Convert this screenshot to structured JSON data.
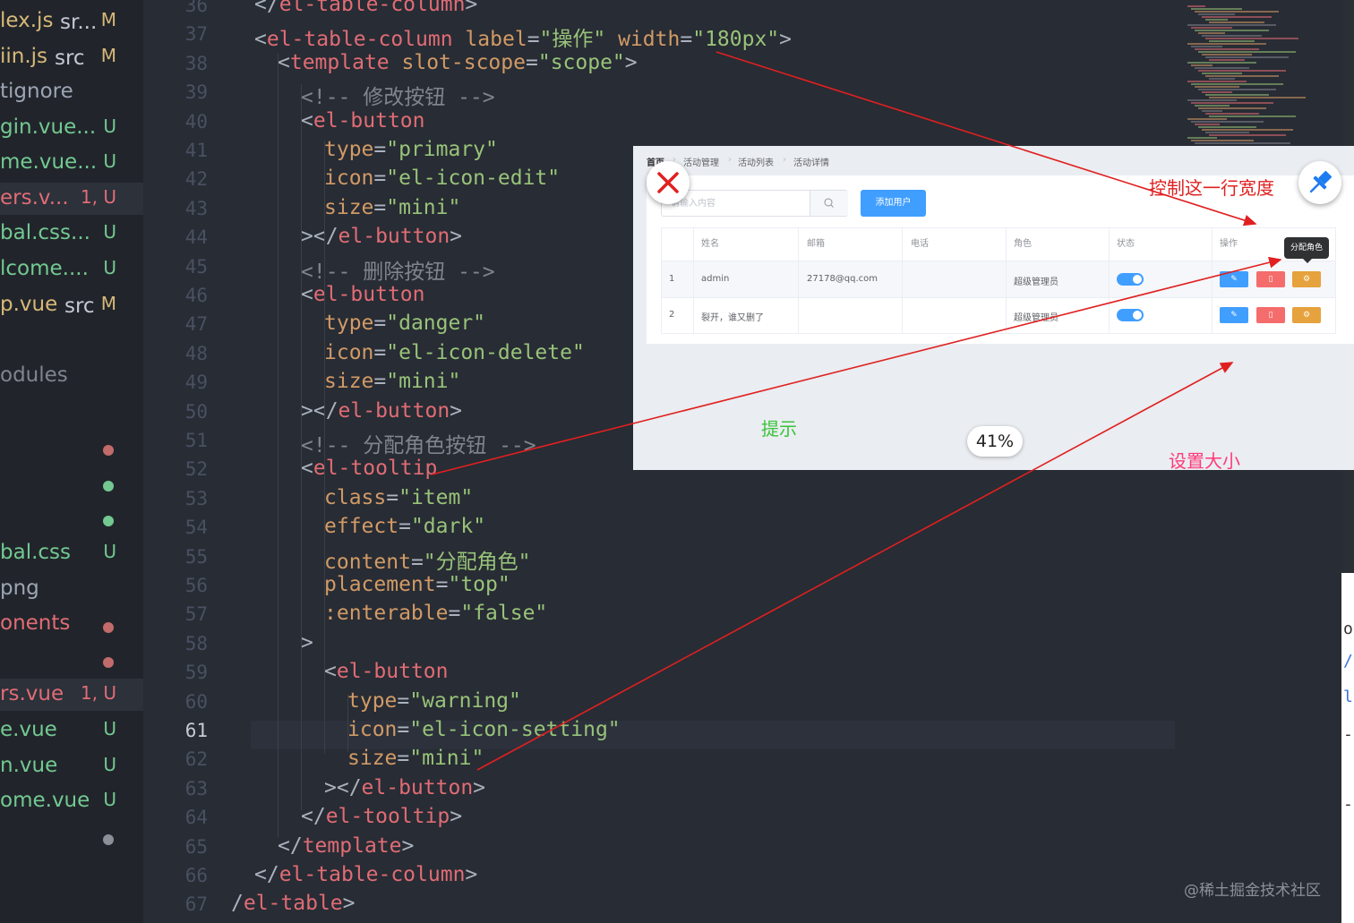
{
  "sidebar": {
    "files": [
      {
        "name": "lex.js",
        "sub": "sr...",
        "badge": "M",
        "color": "#d7b978",
        "badge_color": "#d7b978"
      },
      {
        "name": "iin.js",
        "sub": "src",
        "badge": "M",
        "color": "#d7b978",
        "badge_color": "#d7b978"
      },
      {
        "name": "tignore",
        "sub": "",
        "badge": "",
        "color": "#9da5b4",
        "badge_color": ""
      },
      {
        "name": "gin.vue...",
        "sub": "",
        "badge": "U",
        "color": "#73c991",
        "badge_color": "#73c991"
      },
      {
        "name": "me.vue...",
        "sub": "",
        "badge": "U",
        "color": "#73c991",
        "badge_color": "#73c991"
      },
      {
        "name": "ers.v...",
        "sub": "",
        "badge": "1, U",
        "color": "#e06c75",
        "badge_color": "#e06c75"
      },
      {
        "name": "bal.css...",
        "sub": "",
        "badge": "U",
        "color": "#73c991",
        "badge_color": "#73c991"
      },
      {
        "name": "lcome....",
        "sub": "",
        "badge": "U",
        "color": "#73c991",
        "badge_color": "#73c991"
      },
      {
        "name": "p.vue",
        "sub": "src",
        "badge": "M",
        "color": "#d7b978",
        "badge_color": "#d7b978"
      },
      {
        "name": "odules",
        "sub": "",
        "badge": "",
        "color": "#7f848e",
        "badge_color": ""
      },
      {
        "name": "bal.css",
        "sub": "",
        "badge": "U",
        "color": "#73c991",
        "badge_color": "#73c991"
      },
      {
        "name": "png",
        "sub": "",
        "badge": "",
        "color": "#9da5b4",
        "badge_color": ""
      },
      {
        "name": "onents",
        "sub": "",
        "badge": "",
        "color": "#e06c75",
        "badge_color": ""
      },
      {
        "name": "rs.vue",
        "sub": "",
        "badge": "1, U",
        "color": "#e06c75",
        "badge_color": "#e06c75"
      },
      {
        "name": "e.vue",
        "sub": "",
        "badge": "U",
        "color": "#73c991",
        "badge_color": "#73c991"
      },
      {
        "name": "n.vue",
        "sub": "",
        "badge": "U",
        "color": "#73c991",
        "badge_color": "#73c991"
      },
      {
        "name": "ome.vue",
        "sub": "",
        "badge": "U",
        "color": "#73c991",
        "badge_color": "#73c991"
      }
    ],
    "dot_colors": [
      "#c26b6b",
      "#73c991",
      "#73c991",
      "#c26b6b",
      "#c26b6b",
      "#8a8f98"
    ]
  },
  "editor": {
    "current_line": 61,
    "lines": [
      {
        "n": 36,
        "indent": 0,
        "parts": [
          [
            "pun",
            "</"
          ],
          [
            "tag",
            "el-table-column"
          ],
          [
            "pun",
            ">"
          ]
        ]
      },
      {
        "n": 37,
        "indent": 0,
        "parts": [
          [
            "pun",
            "<"
          ],
          [
            "tag",
            "el-table-column"
          ],
          [
            "pun",
            " "
          ],
          [
            "attr",
            "label"
          ],
          [
            "pun",
            "="
          ],
          [
            "str",
            "\"操作\""
          ],
          [
            "pun",
            " "
          ],
          [
            "attr",
            "width"
          ],
          [
            "pun",
            "="
          ],
          [
            "str",
            "\"180px\""
          ],
          [
            "pun",
            ">"
          ]
        ]
      },
      {
        "n": 38,
        "indent": 1,
        "parts": [
          [
            "pun",
            "<"
          ],
          [
            "tag",
            "template"
          ],
          [
            "pun",
            " "
          ],
          [
            "attr",
            "slot-scope"
          ],
          [
            "pun",
            "="
          ],
          [
            "str",
            "\"scope\""
          ],
          [
            "pun",
            ">"
          ]
        ]
      },
      {
        "n": 39,
        "indent": 2,
        "parts": [
          [
            "cmt",
            "<!-- 修改按钮 -->"
          ]
        ]
      },
      {
        "n": 40,
        "indent": 2,
        "parts": [
          [
            "pun",
            "<"
          ],
          [
            "tag",
            "el-button"
          ]
        ]
      },
      {
        "n": 41,
        "indent": 3,
        "parts": [
          [
            "attr",
            "type"
          ],
          [
            "pun",
            "="
          ],
          [
            "str",
            "\"primary\""
          ]
        ]
      },
      {
        "n": 42,
        "indent": 3,
        "parts": [
          [
            "attr",
            "icon"
          ],
          [
            "pun",
            "="
          ],
          [
            "str",
            "\"el-icon-edit\""
          ]
        ]
      },
      {
        "n": 43,
        "indent": 3,
        "parts": [
          [
            "attr",
            "size"
          ],
          [
            "pun",
            "="
          ],
          [
            "str",
            "\"mini\""
          ]
        ]
      },
      {
        "n": 44,
        "indent": 2,
        "parts": [
          [
            "pun",
            "></"
          ],
          [
            "tag",
            "el-button"
          ],
          [
            "pun",
            ">"
          ]
        ]
      },
      {
        "n": 45,
        "indent": 2,
        "parts": [
          [
            "cmt",
            "<!-- 删除按钮 -->"
          ]
        ]
      },
      {
        "n": 46,
        "indent": 2,
        "parts": [
          [
            "pun",
            "<"
          ],
          [
            "tag",
            "el-button"
          ]
        ]
      },
      {
        "n": 47,
        "indent": 3,
        "parts": [
          [
            "attr",
            "type"
          ],
          [
            "pun",
            "="
          ],
          [
            "str",
            "\"danger\""
          ]
        ]
      },
      {
        "n": 48,
        "indent": 3,
        "parts": [
          [
            "attr",
            "icon"
          ],
          [
            "pun",
            "="
          ],
          [
            "str",
            "\"el-icon-delete\""
          ]
        ]
      },
      {
        "n": 49,
        "indent": 3,
        "parts": [
          [
            "attr",
            "size"
          ],
          [
            "pun",
            "="
          ],
          [
            "str",
            "\"mini\""
          ]
        ]
      },
      {
        "n": 50,
        "indent": 2,
        "parts": [
          [
            "pun",
            "></"
          ],
          [
            "tag",
            "el-button"
          ],
          [
            "pun",
            ">"
          ]
        ]
      },
      {
        "n": 51,
        "indent": 2,
        "parts": [
          [
            "cmt",
            "<!-- 分配角色按钮 -->"
          ]
        ]
      },
      {
        "n": 52,
        "indent": 2,
        "parts": [
          [
            "pun",
            "<"
          ],
          [
            "tag",
            "el-tooltip"
          ]
        ]
      },
      {
        "n": 53,
        "indent": 3,
        "parts": [
          [
            "attr",
            "class"
          ],
          [
            "pun",
            "="
          ],
          [
            "str",
            "\"item\""
          ]
        ]
      },
      {
        "n": 54,
        "indent": 3,
        "parts": [
          [
            "attr",
            "effect"
          ],
          [
            "pun",
            "="
          ],
          [
            "str",
            "\"dark\""
          ]
        ]
      },
      {
        "n": 55,
        "indent": 3,
        "parts": [
          [
            "attr",
            "content"
          ],
          [
            "pun",
            "="
          ],
          [
            "str",
            "\"分配角色\""
          ]
        ]
      },
      {
        "n": 56,
        "indent": 3,
        "parts": [
          [
            "attr",
            "placement"
          ],
          [
            "pun",
            "="
          ],
          [
            "str",
            "\"top\""
          ]
        ]
      },
      {
        "n": 57,
        "indent": 3,
        "parts": [
          [
            "attr",
            ":enterable"
          ],
          [
            "pun",
            "="
          ],
          [
            "str",
            "\"false\""
          ]
        ]
      },
      {
        "n": 58,
        "indent": 2,
        "parts": [
          [
            "pun",
            ">"
          ]
        ]
      },
      {
        "n": 59,
        "indent": 3,
        "parts": [
          [
            "pun",
            "<"
          ],
          [
            "tag",
            "el-button"
          ]
        ]
      },
      {
        "n": 60,
        "indent": 4,
        "parts": [
          [
            "attr",
            "type"
          ],
          [
            "pun",
            "="
          ],
          [
            "str",
            "\"warning\""
          ]
        ]
      },
      {
        "n": 61,
        "indent": 4,
        "parts": [
          [
            "attr",
            "icon"
          ],
          [
            "pun",
            "="
          ],
          [
            "str",
            "\"el-icon-setting\""
          ]
        ]
      },
      {
        "n": 62,
        "indent": 4,
        "parts": [
          [
            "attr",
            "size"
          ],
          [
            "pun",
            "="
          ],
          [
            "str",
            "\"mini\""
          ]
        ]
      },
      {
        "n": 63,
        "indent": 3,
        "parts": [
          [
            "pun",
            "></"
          ],
          [
            "tag",
            "el-button"
          ],
          [
            "pun",
            ">"
          ]
        ]
      },
      {
        "n": 64,
        "indent": 2,
        "parts": [
          [
            "pun",
            "</"
          ],
          [
            "tag",
            "el-tooltip"
          ],
          [
            "pun",
            ">"
          ]
        ]
      },
      {
        "n": 65,
        "indent": 1,
        "parts": [
          [
            "pun",
            "</"
          ],
          [
            "tag",
            "template"
          ],
          [
            "pun",
            ">"
          ]
        ]
      },
      {
        "n": 66,
        "indent": 0,
        "parts": [
          [
            "pun",
            "</"
          ],
          [
            "tag",
            "el-table-column"
          ],
          [
            "pun",
            ">"
          ]
        ]
      },
      {
        "n": 67,
        "indent": -1,
        "parts": [
          [
            "pun",
            "/"
          ],
          [
            "tag",
            "el-table"
          ],
          [
            "pun",
            ">"
          ]
        ]
      }
    ]
  },
  "preview": {
    "breadcrumbs": [
      "首页",
      "活动管理",
      "活动列表",
      "活动详情"
    ],
    "search_placeholder": "请输入内容",
    "add_button": "添加用户",
    "columns": [
      "",
      "姓名",
      "邮箱",
      "电话",
      "角色",
      "状态",
      "操作"
    ],
    "rows": [
      {
        "index": "1",
        "name": "admin",
        "email": "27178@qq.com",
        "phone": "",
        "role": "超级管理员",
        "status_on": true
      },
      {
        "index": "2",
        "name": "裂开，谁又删了",
        "email": "",
        "phone": "",
        "role": "超级管理员",
        "status_on": true
      }
    ],
    "tooltip": "分配角色"
  },
  "annotations": {
    "width_note": "控制这一行宽度",
    "tooltip_note": "提示",
    "size_note": "设置大小",
    "colors": {
      "arrow": "#e02020",
      "width_note": "#e02020",
      "tooltip_note": "#39c43a",
      "size_note": "#ff3a7a"
    }
  },
  "viewer": {
    "zoom": "41%"
  },
  "watermark": "@稀土掘金技术社区"
}
